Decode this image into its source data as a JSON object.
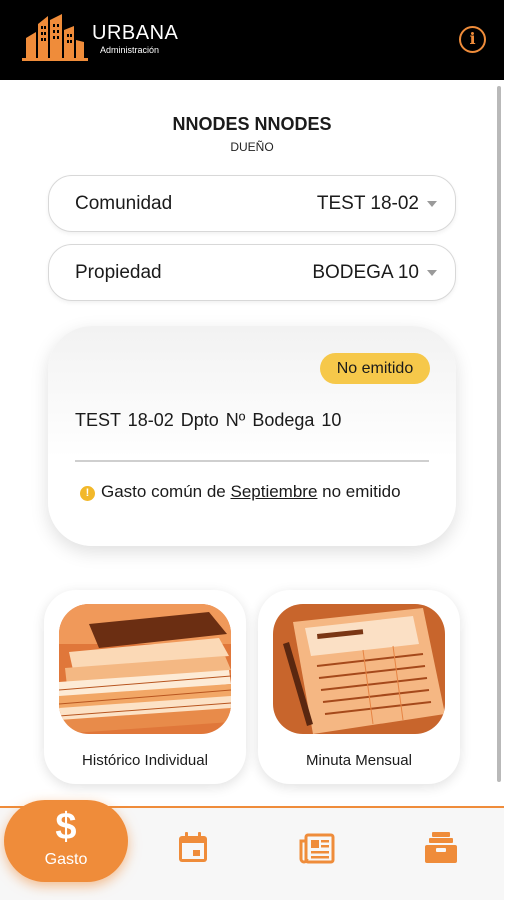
{
  "header": {
    "brand": "URBANA",
    "brand_sub": "Administración",
    "info_icon": "info-icon"
  },
  "user": {
    "name": "NNODES NNODES",
    "role": "DUEÑO"
  },
  "selects": {
    "community": {
      "label": "Comunidad",
      "value": "TEST 18-02"
    },
    "property": {
      "label": "Propiedad",
      "value": "BODEGA 10"
    }
  },
  "status_card": {
    "badge": "No emitido",
    "title": "TEST 18-02  Dpto Nº Bodega 10",
    "message_pre": "Gasto común de",
    "message_month": "Septiembre",
    "message_post": "no emitido"
  },
  "tiles": [
    {
      "label": "Histórico Individual",
      "icon": "paper-stack-photo"
    },
    {
      "label": "Minuta Mensual",
      "icon": "form-document-photo"
    }
  ],
  "bottom_nav": {
    "active": {
      "label": "Gasto",
      "icon": "dollar-icon"
    },
    "items": [
      "calendar-icon",
      "newspaper-icon",
      "archive-icon"
    ]
  },
  "colors": {
    "accent": "#ef8c3a",
    "badge": "#f6c84a",
    "header_bg": "#000000"
  }
}
